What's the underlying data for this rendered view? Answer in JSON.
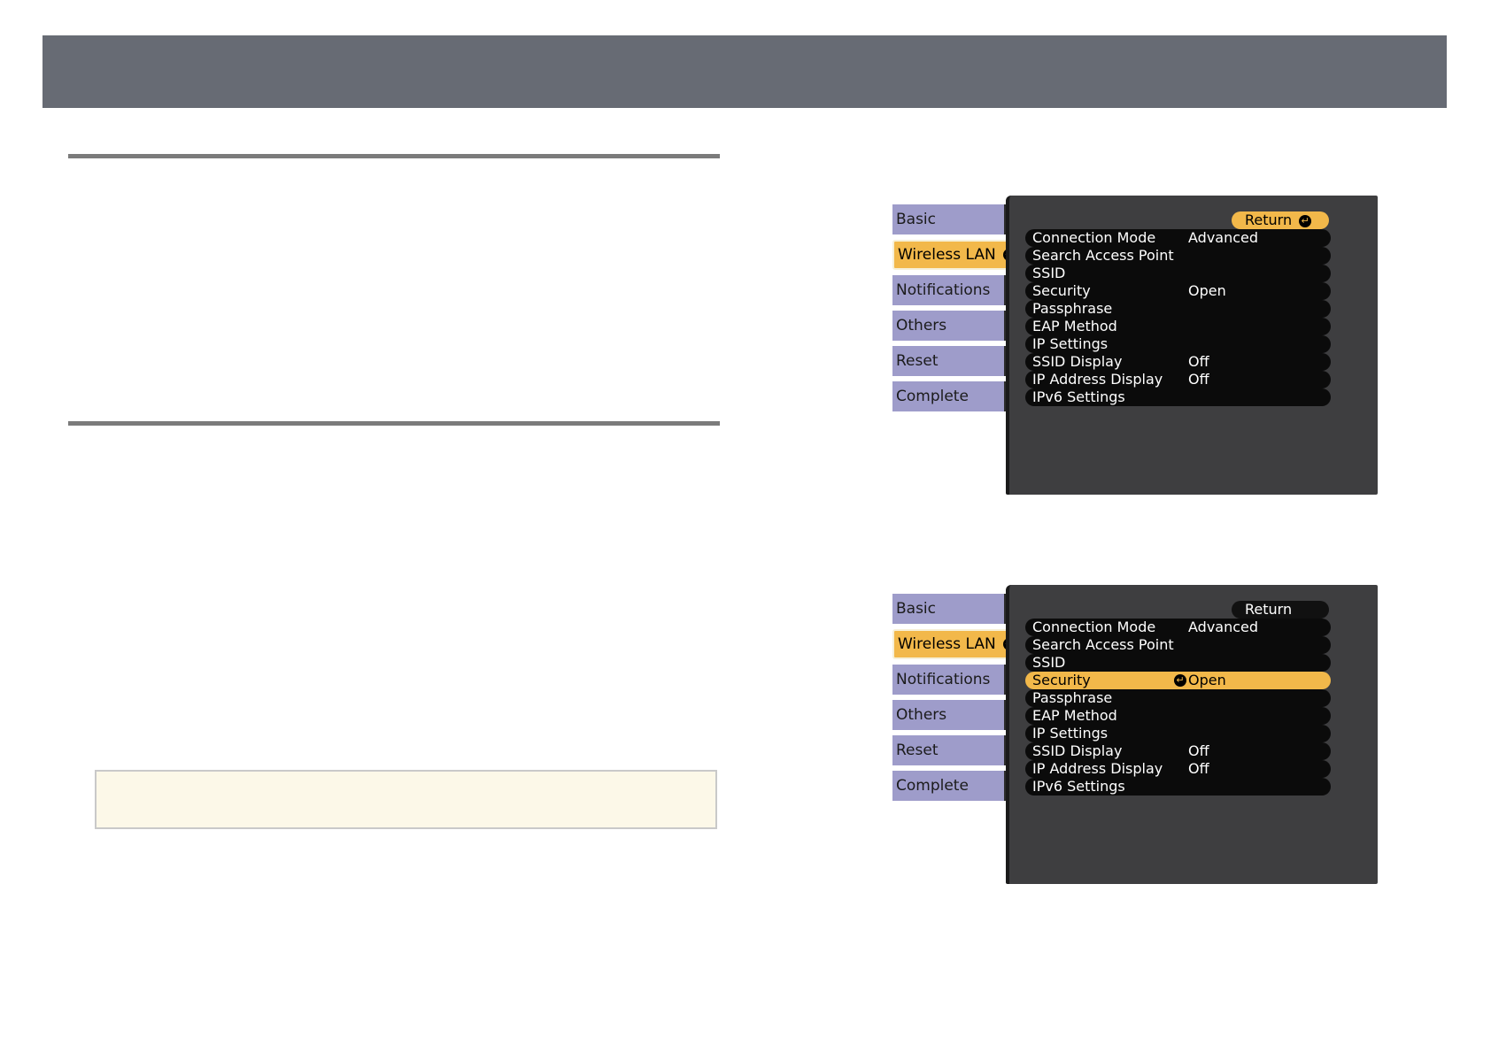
{
  "menus": [
    {
      "tabs": [
        "Basic",
        "Wireless LAN",
        "Notifications",
        "Others",
        "Reset",
        "Complete"
      ],
      "active_tab": "Wireless LAN",
      "return_label": "Return",
      "return_focused": true,
      "rows": [
        {
          "label": "Connection Mode",
          "value": "Advanced"
        },
        {
          "label": "Search Access Point",
          "value": ""
        },
        {
          "label": "SSID",
          "value": ""
        },
        {
          "label": "Security",
          "value": "Open"
        },
        {
          "label": "Passphrase",
          "value": ""
        },
        {
          "label": "EAP Method",
          "value": ""
        },
        {
          "label": "IP Settings",
          "value": ""
        },
        {
          "label": "SSID Display",
          "value": "Off"
        },
        {
          "label": "IP Address Display",
          "value": "Off"
        },
        {
          "label": "IPv6 Settings",
          "value": ""
        }
      ],
      "highlighted_row": ""
    },
    {
      "tabs": [
        "Basic",
        "Wireless LAN",
        "Notifications",
        "Others",
        "Reset",
        "Complete"
      ],
      "active_tab": "Wireless LAN",
      "return_label": "Return",
      "return_focused": false,
      "rows": [
        {
          "label": "Connection Mode",
          "value": "Advanced"
        },
        {
          "label": "Search Access Point",
          "value": ""
        },
        {
          "label": "SSID",
          "value": ""
        },
        {
          "label": "Security",
          "value": "Open"
        },
        {
          "label": "Passphrase",
          "value": ""
        },
        {
          "label": "EAP Method",
          "value": ""
        },
        {
          "label": "IP Settings",
          "value": ""
        },
        {
          "label": "SSID Display",
          "value": "Off"
        },
        {
          "label": "IP Address Display",
          "value": "Off"
        },
        {
          "label": "IPv6 Settings",
          "value": ""
        }
      ],
      "highlighted_row": "Security"
    }
  ],
  "colors": {
    "banner": "#676b74",
    "tab": "#9e9cca",
    "active": "#f2b84a",
    "screen": "#3e3e40",
    "note_bg": "#fcf8e8"
  }
}
